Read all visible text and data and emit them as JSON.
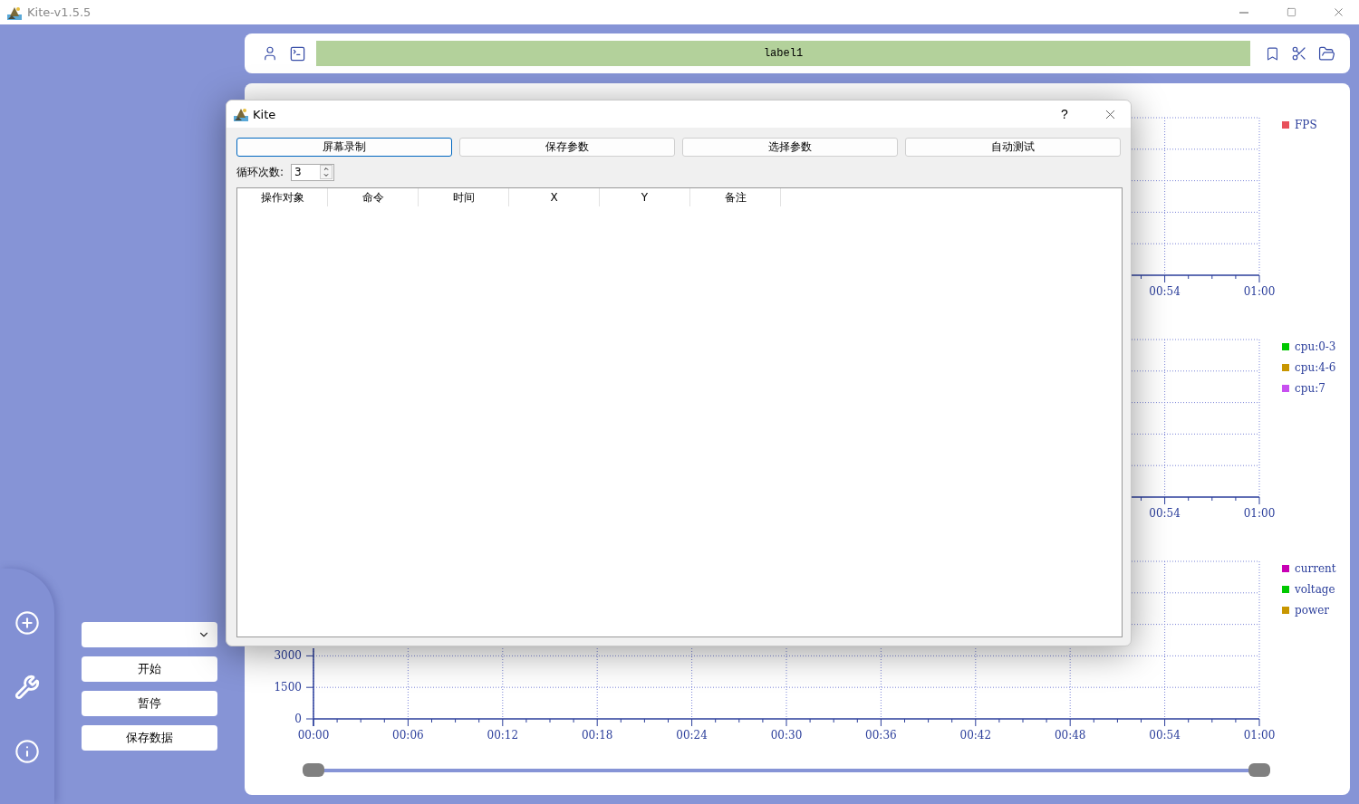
{
  "window": {
    "title": "Kite-v1.5.5"
  },
  "toolbar": {
    "label": "label1"
  },
  "charts": [
    {
      "x_ticks": [
        "00:54",
        "01:00"
      ],
      "legend": [
        {
          "name": "FPS",
          "color": "#e8505b"
        }
      ]
    },
    {
      "x_ticks": [
        "00:54",
        "01:00"
      ],
      "legend": [
        {
          "name": "cpu:0-3",
          "color": "#00c800"
        },
        {
          "name": "cpu:4-6",
          "color": "#c89600"
        },
        {
          "name": "cpu:7",
          "color": "#c850f0"
        }
      ]
    },
    {
      "x_ticks": [
        "00:00",
        "00:06",
        "00:12",
        "00:18",
        "00:24",
        "00:30",
        "00:36",
        "00:42",
        "00:48",
        "00:54",
        "01:00"
      ],
      "y_ticks": [
        "3000",
        "1500",
        "0"
      ],
      "legend": [
        {
          "name": "current",
          "color": "#c800b4"
        },
        {
          "name": "voltage",
          "color": "#00c800"
        },
        {
          "name": "power",
          "color": "#c89600"
        }
      ]
    }
  ],
  "range_slider": {
    "thumbs": [
      {
        "level": 0
      },
      {
        "level": 1
      }
    ]
  },
  "side_buttons": [
    "开始",
    "暂停",
    "保存数据"
  ],
  "dialog": {
    "title": "Kite",
    "help": "?",
    "buttons": [
      {
        "label": "屏幕录制",
        "selected": true
      },
      {
        "label": "保存参数",
        "selected": false
      },
      {
        "label": "选择参数",
        "selected": false
      },
      {
        "label": "自动测试",
        "selected": false
      }
    ],
    "loop_count": {
      "label": "循环次数:",
      "value": "3"
    },
    "table": {
      "columns": [
        "操作对象",
        "命令",
        "时间",
        "X",
        "Y",
        "备注"
      ]
    }
  }
}
